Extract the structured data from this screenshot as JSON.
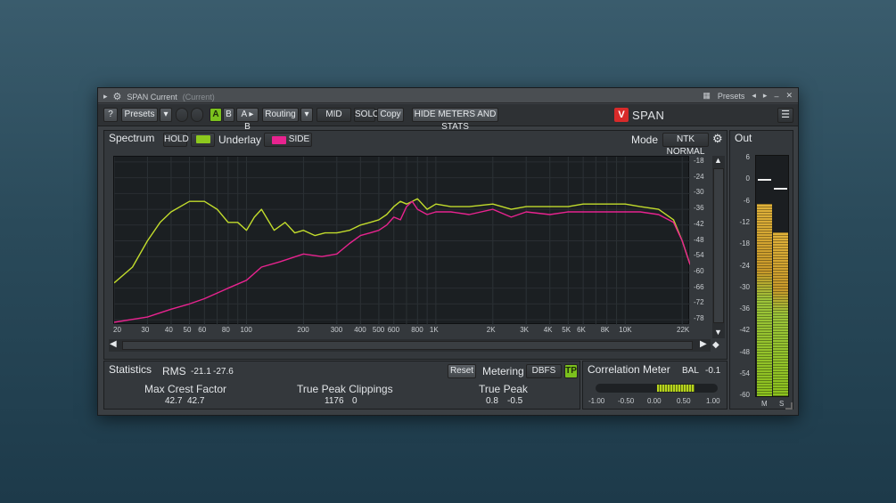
{
  "titlebar": {
    "title": "SPAN Current",
    "subtitle": "(Current)",
    "presets_label": "Presets"
  },
  "toolbar": {
    "help": "?",
    "presets": "Presets",
    "dropdown": "▾",
    "a": "A",
    "b": "B",
    "atob": "A ▸ B",
    "routing": "Routing",
    "mid": "MID",
    "solo": "SOLO",
    "copy": "Copy",
    "hide_meters": "HIDE METERS AND STATS",
    "brand": "SPAN"
  },
  "spectrum": {
    "title": "Spectrum",
    "hold": "HOLD",
    "underlay": "Underlay",
    "side": "SIDE",
    "mode_label": "Mode",
    "mode_value": "NTK NORMAL",
    "db_ticks": [
      "-18",
      "-24",
      "-30",
      "-36",
      "-42",
      "-48",
      "-54",
      "-60",
      "-66",
      "-72",
      "-78"
    ],
    "freq_ticks": [
      "20",
      "30",
      "40",
      "50",
      "60",
      "80",
      "100",
      "200",
      "300",
      "400",
      "500",
      "600",
      "800",
      "1K",
      "2K",
      "3K",
      "4K",
      "5K",
      "6K",
      "8K",
      "10K",
      "22K"
    ],
    "colors": {
      "mid": "#c2dc2c",
      "side": "#e8238f"
    }
  },
  "chart_data": {
    "type": "line",
    "xlabel": "",
    "ylabel": "",
    "xscale": "log",
    "xlim": [
      20,
      22000
    ],
    "ylim": [
      -80,
      -16
    ],
    "series": [
      {
        "x": [
          20,
          25,
          30,
          35,
          40,
          50,
          60,
          70,
          80,
          90,
          100,
          110,
          120,
          140,
          160,
          180,
          200,
          230,
          260,
          300,
          350,
          400,
          450,
          500,
          550,
          600,
          650,
          700,
          750,
          800,
          900,
          1000,
          1200,
          1500,
          2000,
          2500,
          3000,
          4000,
          5000,
          6000,
          8000,
          10000,
          12000,
          15000,
          18000,
          20000,
          22000
        ],
        "y": [
          -64,
          -58,
          -48,
          -41,
          -37,
          -33,
          -33,
          -36,
          -41,
          -41,
          -44,
          -39,
          -36,
          -44,
          -41,
          -45,
          -44,
          -46,
          -45,
          -45,
          -44,
          -42,
          -41,
          -40,
          -38,
          -35,
          -33,
          -34,
          -33,
          -32,
          -36,
          -34,
          -35,
          -35,
          -34,
          -36,
          -35,
          -35,
          -35,
          -34,
          -34,
          -34,
          -35,
          -36,
          -40,
          -48,
          -57
        ]
      },
      {
        "x": [
          20,
          30,
          40,
          50,
          60,
          80,
          100,
          120,
          150,
          200,
          250,
          300,
          350,
          400,
          450,
          500,
          550,
          600,
          650,
          700,
          750,
          800,
          900,
          1000,
          1200,
          1500,
          2000,
          2500,
          3000,
          4000,
          5000,
          6000,
          8000,
          10000,
          12000,
          15000,
          18000,
          20000,
          22000
        ],
        "y": [
          -79,
          -77,
          -74,
          -72,
          -70,
          -66,
          -63,
          -58,
          -56,
          -53,
          -54,
          -53,
          -49,
          -46,
          -45,
          -44,
          -42,
          -39,
          -40,
          -35,
          -33,
          -36,
          -38,
          -37,
          -37,
          -38,
          -36,
          -39,
          -37,
          -38,
          -37,
          -37,
          -37,
          -37,
          -37,
          -38,
          -41,
          -48,
          -57
        ]
      }
    ]
  },
  "stats": {
    "title": "Statistics",
    "rms_label": "RMS",
    "rms_l": "-21.1",
    "rms_r": "-27.6",
    "reset": "Reset",
    "metering_label": "Metering",
    "metering_value": "DBFS",
    "tp": "TP",
    "max_crest_label": "Max Crest Factor",
    "max_crest_l": "42.7",
    "max_crest_r": "42.7",
    "tp_clip_label": "True Peak Clippings",
    "tp_clip_l": "1176",
    "tp_clip_r": "0",
    "true_peak_label": "True Peak",
    "true_peak_l": "0.8",
    "true_peak_r": "-0.5"
  },
  "correlation": {
    "title": "Correlation Meter",
    "bal_label": "BAL",
    "bal_value": "-0.1",
    "ticks": [
      "-1.00",
      "-0.50",
      "0.00",
      "0.50",
      "1.00"
    ],
    "level": 0.62
  },
  "out": {
    "title": "Out",
    "ticks": [
      "6",
      "0",
      "-6",
      "-12",
      "-18",
      "-24",
      "-30",
      "-36",
      "-42",
      "-48",
      "-54",
      "-60"
    ],
    "m_label": "M",
    "s_label": "S",
    "m_level": 0.8,
    "s_level": 0.68
  }
}
